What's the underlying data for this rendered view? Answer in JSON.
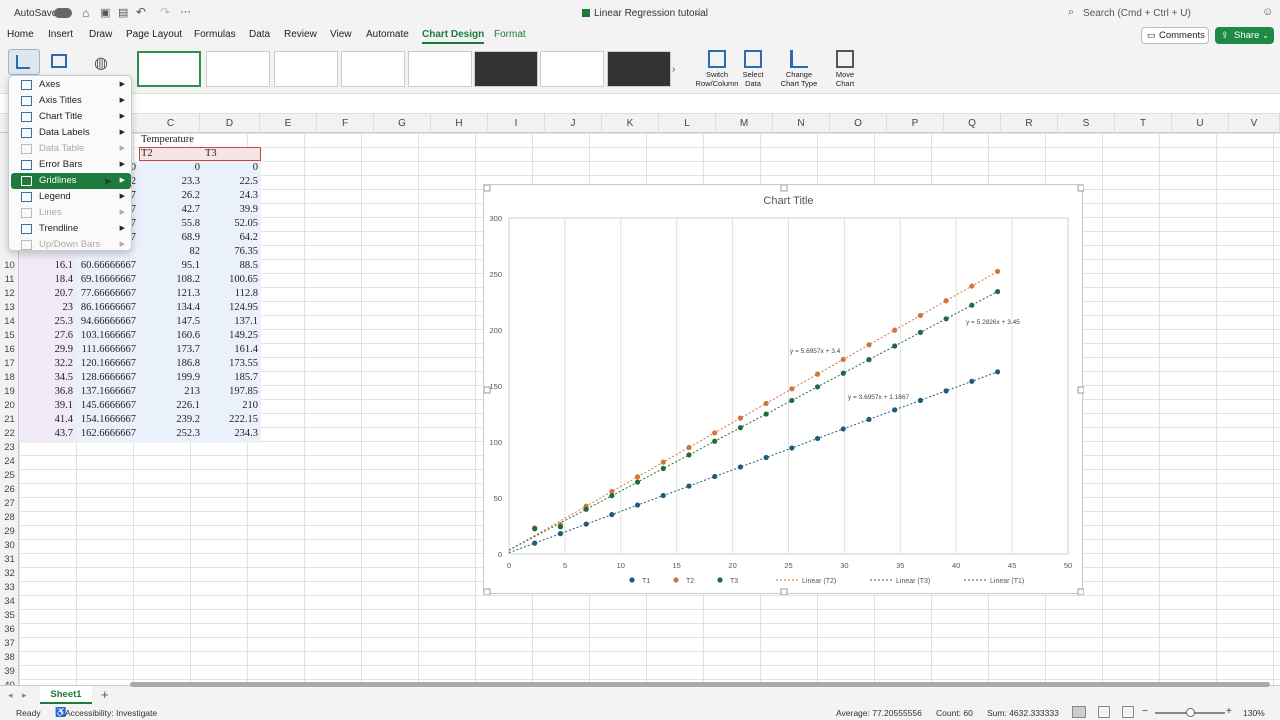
{
  "titlebar": {
    "autosave": "AutoSave",
    "doc_title": "Linear Regression tutorial",
    "search": "Search (Cmd + Ctrl + U)"
  },
  "tabs": [
    "Home",
    "Insert",
    "Draw",
    "Page Layout",
    "Formulas",
    "Data",
    "Review",
    "View",
    "Automate",
    "Chart Design",
    "Format"
  ],
  "actions": {
    "comments": "Comments",
    "share": "Share"
  },
  "ribbon": {
    "switch_label_1": "Switch",
    "switch_label_2": "Row/Column",
    "select_label_1": "Select",
    "select_label_2": "Data",
    "change_label_1": "Change",
    "change_label_2": "Chart Type",
    "move_label_1": "Move",
    "move_label_2": "Chart"
  },
  "columns": [
    "C",
    "D",
    "E",
    "F",
    "G",
    "H",
    "I",
    "J",
    "K",
    "L",
    "M",
    "N",
    "O",
    "P",
    "Q",
    "R",
    "S",
    "T",
    "U",
    "V"
  ],
  "rows": [
    "10",
    "11",
    "12",
    "13",
    "14",
    "15",
    "16",
    "17",
    "18",
    "19",
    "20",
    "21",
    "22",
    "23",
    "24",
    "25",
    "26",
    "27",
    "28",
    "29",
    "30",
    "31",
    "32",
    "33",
    "34",
    "35",
    "36",
    "37",
    "38",
    "39",
    "40"
  ],
  "sheet": {
    "header_temperature": "Temperature",
    "header_t2": "T2",
    "header_t3": "T3",
    "partial_rows": [
      [
        "0",
        "0",
        "0"
      ],
      [
        "2",
        "23.3",
        "22.5"
      ],
      [
        "7",
        "26.2",
        "24.3"
      ],
      [
        "7",
        "42.7",
        "39.9"
      ],
      [
        "7",
        "55.8",
        "52.05"
      ],
      [
        "7",
        "68.9",
        "64.2"
      ],
      [
        "",
        "82",
        "76.35"
      ]
    ],
    "rows": [
      [
        "16.1",
        "60.66666667",
        "95.1",
        "88.5"
      ],
      [
        "18.4",
        "69.16666667",
        "108.2",
        "100.65"
      ],
      [
        "20.7",
        "77.66666667",
        "121.3",
        "112.8"
      ],
      [
        "23",
        "86.16666667",
        "134.4",
        "124.95"
      ],
      [
        "25.3",
        "94.66666667",
        "147.5",
        "137.1"
      ],
      [
        "27.6",
        "103.1666667",
        "160.6",
        "149.25"
      ],
      [
        "29.9",
        "111.6666667",
        "173.7",
        "161.4"
      ],
      [
        "32.2",
        "120.1666667",
        "186.8",
        "173.55"
      ],
      [
        "34.5",
        "128.6666667",
        "199.9",
        "185.7"
      ],
      [
        "36.8",
        "137.1666667",
        "213",
        "197.85"
      ],
      [
        "39.1",
        "145.6666667",
        "226.1",
        "210"
      ],
      [
        "41.4",
        "154.1666667",
        "239.2",
        "222.15"
      ],
      [
        "43.7",
        "162.6666667",
        "252.3",
        "234.3"
      ]
    ]
  },
  "menu": {
    "items": [
      {
        "label": "Axes",
        "icon": "axes-icon",
        "disabled": false
      },
      {
        "label": "Axis Titles",
        "icon": "axis-titles-icon",
        "disabled": false
      },
      {
        "label": "Chart Title",
        "icon": "chart-title-icon",
        "disabled": false
      },
      {
        "label": "Data Labels",
        "icon": "data-labels-icon",
        "disabled": false
      },
      {
        "label": "Data Table",
        "icon": "data-table-icon",
        "disabled": true
      },
      {
        "label": "Error Bars",
        "icon": "error-bars-icon",
        "disabled": false
      },
      {
        "label": "Gridlines",
        "icon": "gridlines-icon",
        "disabled": false,
        "highlighted": true
      },
      {
        "label": "Legend",
        "icon": "legend-icon",
        "disabled": false
      },
      {
        "label": "Lines",
        "icon": "lines-icon",
        "disabled": true
      },
      {
        "label": "Trendline",
        "icon": "trendline-icon",
        "disabled": false
      },
      {
        "label": "Up/Down Bars",
        "icon": "updown-bars-icon",
        "disabled": true
      }
    ]
  },
  "chart_data": {
    "type": "scatter",
    "title": "Chart Title",
    "xlim": [
      0,
      50
    ],
    "ylim": [
      0,
      300
    ],
    "xticks": [
      0,
      5,
      10,
      15,
      20,
      25,
      30,
      35,
      40,
      45,
      50
    ],
    "yticks": [
      0,
      50,
      100,
      150,
      200,
      250,
      300
    ],
    "grid": "vertical",
    "legend": "bottom",
    "x": [
      2.3,
      4.6,
      6.9,
      9.2,
      11.5,
      13.8,
      16.1,
      18.4,
      20.7,
      23,
      25.3,
      27.6,
      29.9,
      32.2,
      34.5,
      36.8,
      39.1,
      41.4,
      43.7
    ],
    "series": [
      {
        "name": "T1",
        "color": "#1f5c78",
        "values": [
          9.7,
          18.2,
          26.7,
          35.2,
          43.7,
          52.2,
          60.67,
          69.17,
          77.67,
          86.17,
          94.67,
          103.17,
          111.67,
          120.17,
          128.67,
          137.17,
          145.67,
          154.17,
          162.67
        ]
      },
      {
        "name": "T2",
        "color": "#d4743a",
        "values": [
          23.3,
          26.2,
          42.7,
          55.8,
          68.9,
          82,
          95.1,
          108.2,
          121.3,
          134.4,
          147.5,
          160.6,
          173.7,
          186.8,
          199.9,
          213,
          226.1,
          239.2,
          252.3
        ]
      },
      {
        "name": "T3",
        "color": "#1f6b3e",
        "values": [
          22.5,
          24.3,
          39.9,
          52.05,
          64.2,
          76.35,
          88.5,
          100.65,
          112.8,
          124.95,
          137.1,
          149.25,
          161.4,
          173.55,
          185.7,
          197.85,
          210,
          222.15,
          234.3
        ]
      }
    ],
    "trendlines": [
      {
        "name": "Linear (T2)",
        "series": "T2",
        "slope": 5.6957,
        "intercept": 3.4,
        "label": "y = 5.6957x + 3.4"
      },
      {
        "name": "Linear (T3)",
        "series": "T3",
        "slope": 5.2826,
        "intercept": 3.45,
        "label": "y = 5.2826x + 3.45"
      },
      {
        "name": "Linear (T1)",
        "series": "T1",
        "slope": 3.6957,
        "intercept": 1.1667,
        "label": "y = 3.6957x + 1.1667"
      }
    ]
  },
  "sheettab": "Sheet1",
  "status": {
    "ready": "Ready",
    "accessibility": "Accessibility: Investigate",
    "average": "Average: 77.20555556",
    "count": "Count: 60",
    "sum": "Sum: 4632.333333",
    "zoom": "130%"
  }
}
